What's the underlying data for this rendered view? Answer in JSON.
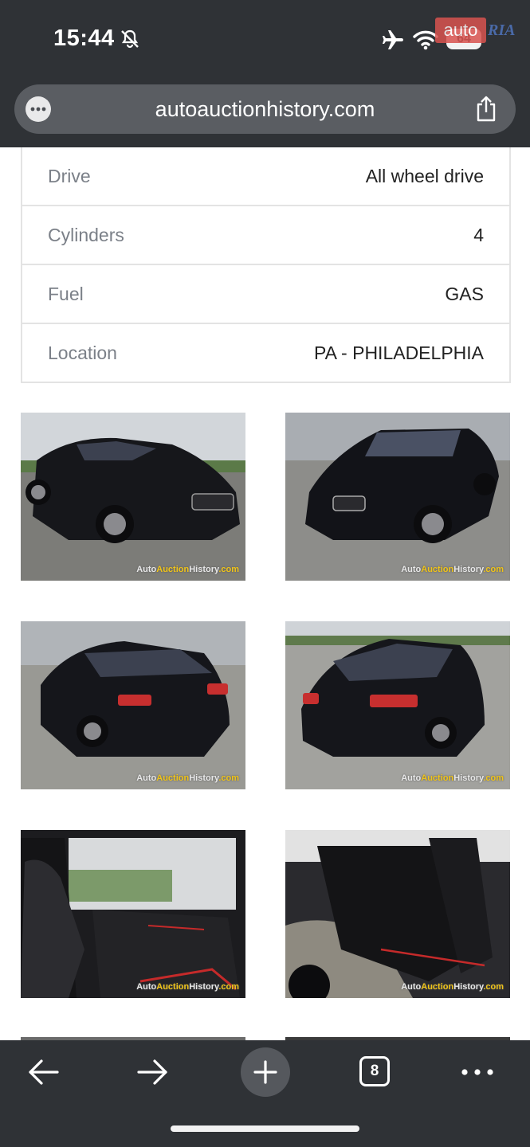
{
  "status_bar": {
    "time": "15:44",
    "battery": "64",
    "icons": [
      "bell-slash-icon",
      "airplane-icon",
      "wifi-icon",
      "battery-icon"
    ]
  },
  "watermark": {
    "auto": "auto",
    "ria": "RIA"
  },
  "browser": {
    "url": "autoauctionhistory.com",
    "icons": [
      "more-dots-icon",
      "share-icon"
    ]
  },
  "specs": [
    {
      "label": "Drive",
      "value": "All wheel drive"
    },
    {
      "label": "Cylinders",
      "value": "4"
    },
    {
      "label": "Fuel",
      "value": "GAS"
    },
    {
      "label": "Location",
      "value": "PA - PHILADELPHIA"
    }
  ],
  "photo_watermark": {
    "auto": "Auto",
    "auction": "Auction",
    "history": "History",
    "com": ".com"
  },
  "toolbar": {
    "tab_count": "8",
    "icons": [
      "back-arrow-icon",
      "forward-arrow-icon",
      "plus-icon",
      "tabs-icon",
      "more-dots-icon"
    ]
  },
  "colors": {
    "chrome": "#2f3236",
    "url_bar": "#5a5d62",
    "table_border": "#e3e3e3",
    "label": "#7b8088",
    "value": "#222222"
  }
}
